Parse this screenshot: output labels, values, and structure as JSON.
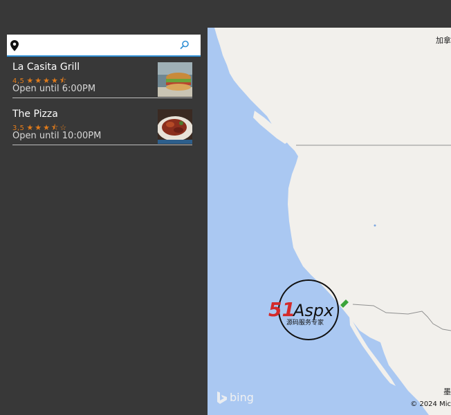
{
  "search": {
    "value": "",
    "placeholder": ""
  },
  "results": [
    {
      "name": "La Casita Grill",
      "rating": "4,5",
      "stars": "★★★★⯪",
      "hours": "Open until 6:00PM"
    },
    {
      "name": "The Pizza",
      "rating": "3,5",
      "stars": "★★★⯪☆",
      "hours": "Open until 10:00PM"
    }
  ],
  "map": {
    "label_top_right": "加拿",
    "label_bottom_right": "墨",
    "copyright": "© 2024 Mic",
    "bing": "bing"
  },
  "watermark": {
    "brand": "51Aspx",
    "tagline": "源码服务专家"
  },
  "colors": {
    "sidebar_bg": "#383838",
    "accent": "#2f8fd4",
    "rating": "#e07b1b",
    "water": "#aac8f2",
    "land": "#f2f0ec"
  }
}
